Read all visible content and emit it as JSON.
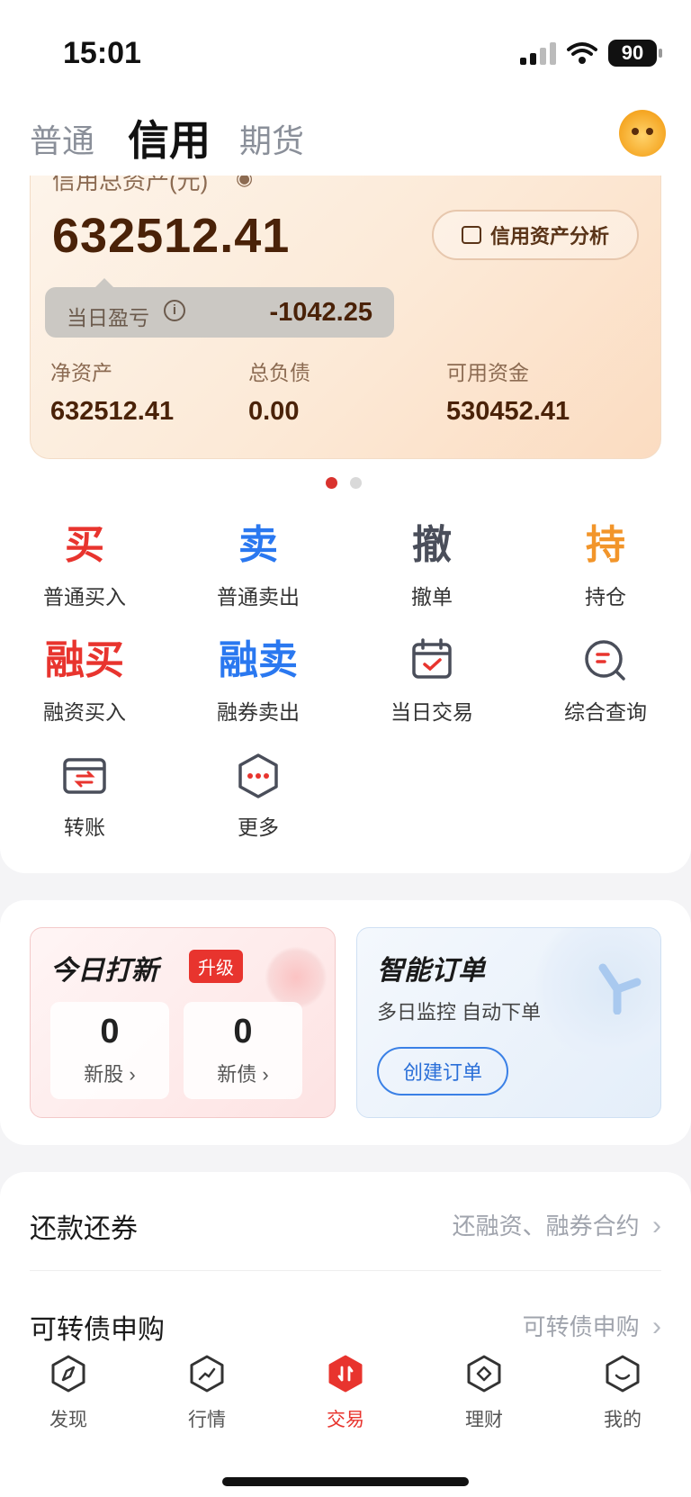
{
  "status_bar": {
    "time": "15:01",
    "battery": "90"
  },
  "tabs": [
    {
      "label": "普通",
      "active": false
    },
    {
      "label": "信用",
      "active": true
    },
    {
      "label": "期货",
      "active": false
    }
  ],
  "asset_card": {
    "total_label": "信用总资产(元)",
    "total_value": "632512.41",
    "analyze_label": "信用资产分析",
    "pnl_label": "当日盈亏",
    "pnl_value": "-1042.25",
    "stats": [
      {
        "label": "净资产",
        "value": "632512.41"
      },
      {
        "label": "总负债",
        "value": "0.00"
      },
      {
        "label": "可用资金",
        "value": "530452.41"
      }
    ]
  },
  "menu": [
    {
      "glyph": "买",
      "label": "普通买入",
      "color": "#e8342e"
    },
    {
      "glyph": "卖",
      "label": "普通卖出",
      "color": "#2a78f0"
    },
    {
      "glyph": "撤",
      "label": "撤单",
      "color": "#4a4e5a"
    },
    {
      "glyph": "持",
      "label": "持仓",
      "color": "#f2952a"
    },
    {
      "glyph": "融买",
      "label": "融资买入",
      "color": "#e8342e"
    },
    {
      "glyph": "融卖",
      "label": "融券卖出",
      "color": "#2a78f0"
    },
    {
      "icon": "calendar-check-icon",
      "label": "当日交易"
    },
    {
      "icon": "search-query-icon",
      "label": "综合查询"
    },
    {
      "icon": "transfer-icon",
      "label": "转账"
    },
    {
      "icon": "more-hex-icon",
      "label": "更多"
    }
  ],
  "ipo": {
    "title": "今日打新",
    "badge": "升级",
    "stock_count": "0",
    "stock_label": "新股",
    "bond_count": "0",
    "bond_label": "新债"
  },
  "smart_order": {
    "title": "智能订单",
    "subtitle": "多日监控 自动下单",
    "button": "创建订单"
  },
  "list": [
    {
      "label": "还款还券",
      "value": "还融资、融券合约"
    },
    {
      "label": "可转债申购",
      "value": "可转债申购"
    }
  ],
  "bottom_nav": [
    {
      "label": "发现",
      "icon": "compass-icon",
      "active": false
    },
    {
      "label": "行情",
      "icon": "chart-trend-icon",
      "active": false
    },
    {
      "label": "交易",
      "icon": "trade-icon",
      "active": true
    },
    {
      "label": "理财",
      "icon": "diamond-icon",
      "active": false
    },
    {
      "label": "我的",
      "icon": "profile-icon",
      "active": false
    }
  ]
}
